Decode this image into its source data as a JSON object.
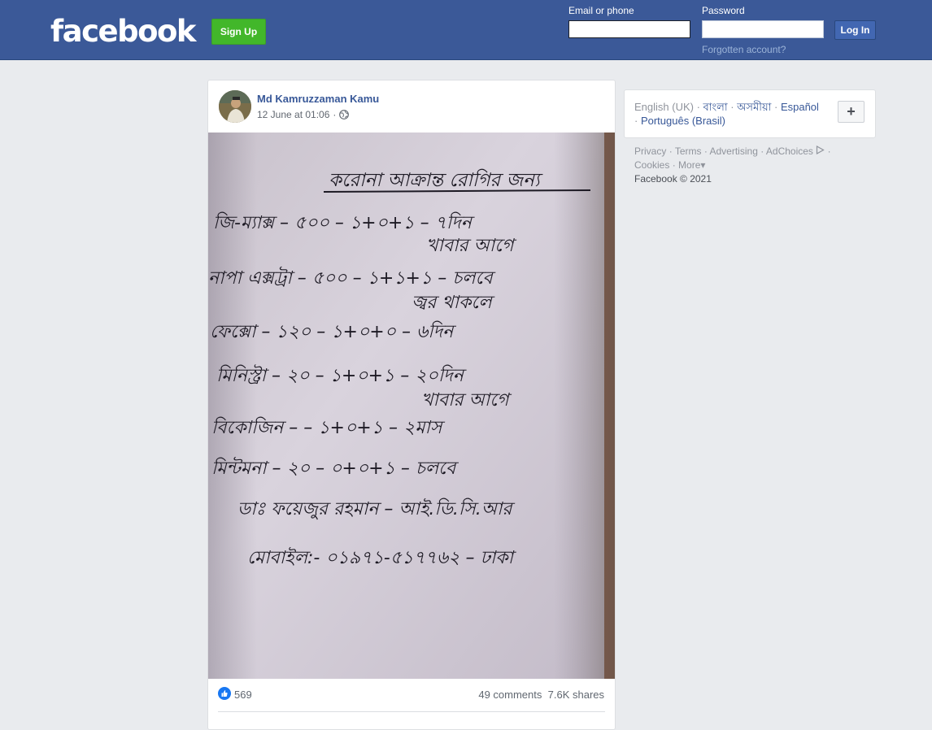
{
  "header": {
    "logo": "facebook",
    "signup_label": "Sign Up",
    "email_label": "Email or phone",
    "password_label": "Password",
    "login_label": "Log In",
    "forgot_label": "Forgotten account?",
    "email_value": "",
    "password_value": ""
  },
  "post": {
    "author": "Md Kamruzzaman Kamu",
    "time": "12 June at 01:06",
    "privacy_icon": "globe-icon",
    "likes": "569",
    "comments": "49 comments",
    "shares": "7.6K shares",
    "photo_lines": [
      "করোনা আক্রান্ত রোগির জন্য",
      "জি-ম্যাক্স – ৫০০ – ১+০+১ – ৭দিন",
      "খাবার আগে",
      "নাপা এক্সট্রা – ৫০০ – ১+১+১ – চলবে",
      "জ্বর থাকলে",
      "ফেক্সো – ১২০ – ১+০+০ – ৬দিন",
      "মিনিস্ট্রা – ২০ – ১+০+১ – ২০দিন",
      "খাবার আগে",
      "বিকোজিন – – ১+০+১ – ২মাস",
      "মিন্টমনা – ২০ – ০+০+১ – চলবে",
      "ডাঃ ফয়েজুর রহমান – আই.ডি.সি.আর",
      "মোবাইল:- ০১৯৭১-৫১৭৭৬২ – ঢাকা"
    ]
  },
  "sidebar": {
    "languages": [
      {
        "label": "English (UK)",
        "active": true
      },
      {
        "label": "বাংলা"
      },
      {
        "label": "অসমীয়া"
      },
      {
        "label": "Español"
      },
      {
        "label": "Português (Brasil)"
      }
    ],
    "add_language_label": "+",
    "footer_links": [
      "Privacy",
      "Terms",
      "Advertising",
      "AdChoices",
      "Cookies",
      "More"
    ],
    "copyright": "Facebook © 2021"
  },
  "colors": {
    "brand_blue": "#3b5998",
    "signup_green": "#42b72a",
    "link_blue": "#385898",
    "page_bg": "#e9ebee"
  }
}
